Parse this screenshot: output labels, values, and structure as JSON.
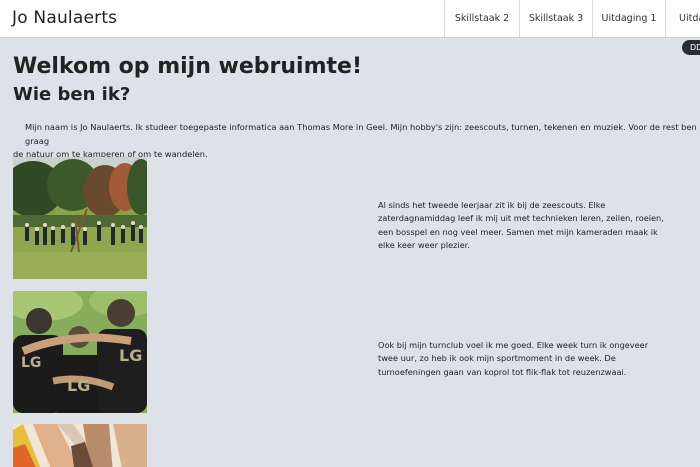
{
  "header": {
    "brand": "Jo Naulaerts",
    "nav": [
      "Skillstaak 2",
      "Skillstaak 3",
      "Uitdaging 1",
      "Uitda"
    ]
  },
  "badge": "DD",
  "main": {
    "title": "Welkom op mijn webruimte!",
    "subtitle": "Wie ben ik?",
    "intro_line1": "Mijn naam is Jo Naulaerts. Ik studeer toegepaste informatica aan Thomas More in Geel. Mijn hobby's zijn: zeescouts, turnen, tekenen en muziek. Voor de rest ben ik graag",
    "intro_line2": "de natuur om te kamperen of om te wandelen.",
    "sections": [
      {
        "image": "scouts-photo",
        "text": "Al sinds het tweede leerjaar zit ik bij de zeescouts. Elke zaterdagnamiddag leef ik mij uit met technieken leren, zeilen, roeien, een bosspel en nog veel meer. Samen met mijn kameraden maak ik elke keer weer plezier."
      },
      {
        "image": "gym-club-photo",
        "text": "Ook bij mijn turnclub voel ik me goed. Elke week turn ik ongeveer twee uur, zo heb ik ook mijn sportmoment in de week. De turnoefeningen gaan van koprol tot flik-flak tot reuzenzwaai."
      },
      {
        "image": "colored-pencils-photo",
        "text": ""
      }
    ],
    "photo_text": "LG"
  }
}
